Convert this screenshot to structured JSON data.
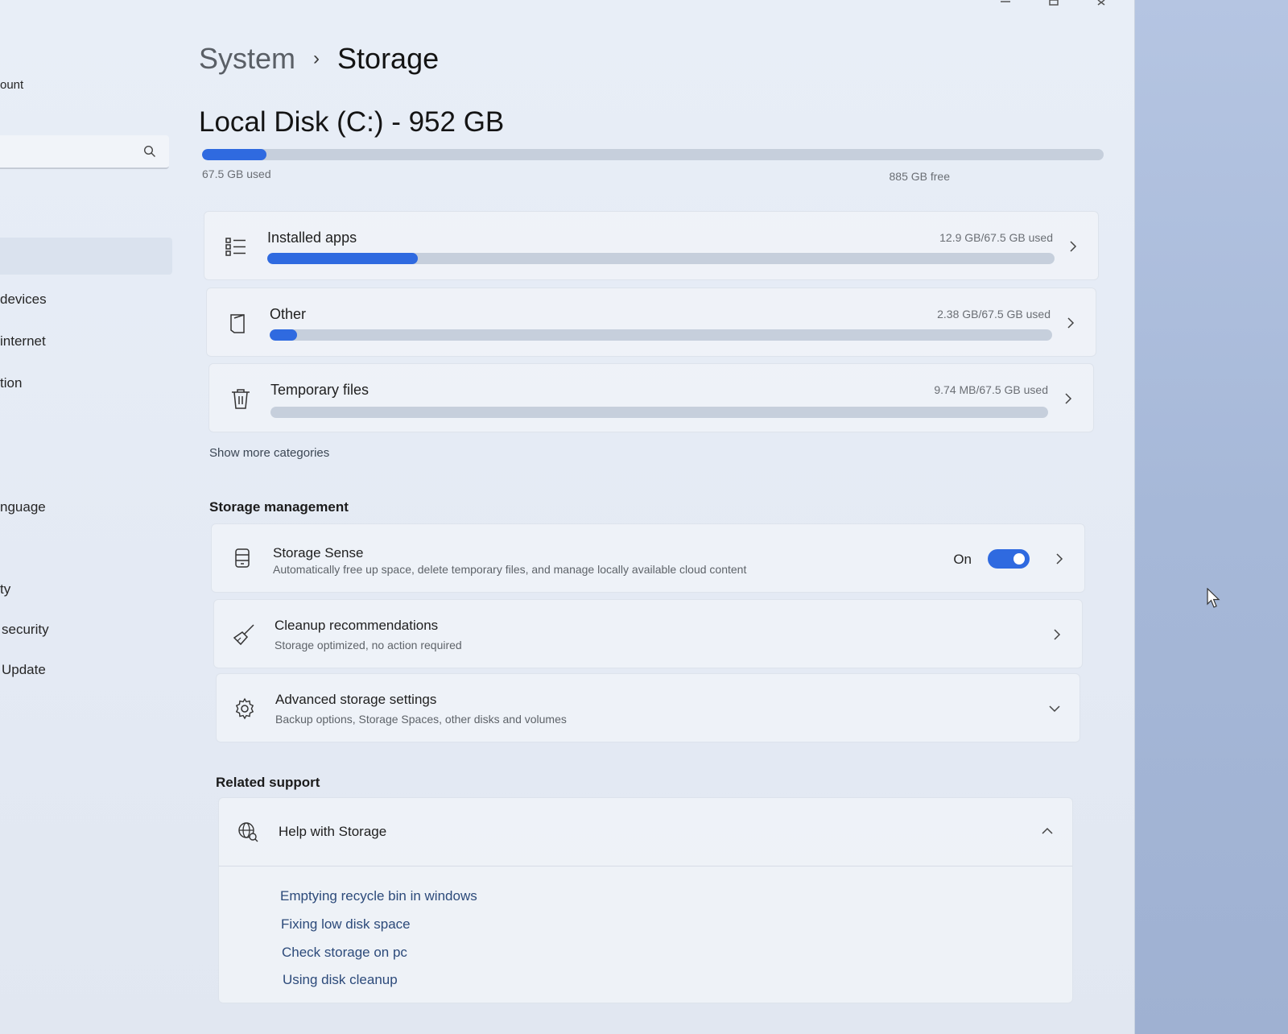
{
  "sidebar": {
    "items": [
      {
        "label": "ount"
      },
      {
        "label": "devices"
      },
      {
        "label": "internet"
      },
      {
        "label": "tion"
      },
      {
        "label": "nguage"
      },
      {
        "label": "ty"
      },
      {
        "label": "security"
      },
      {
        "label": "Update"
      }
    ]
  },
  "breadcrumb": {
    "parent": "System",
    "separator": "›",
    "current": "Storage"
  },
  "disk": {
    "title": "Local Disk (C:) - 952 GB",
    "used_label": "67.5 GB used",
    "free_label": "885 GB free",
    "used_fraction": 0.071
  },
  "categories": [
    {
      "label": "Installed apps",
      "value": "12.9 GB/67.5 GB used",
      "fraction": 0.191,
      "icon": "list-icon"
    },
    {
      "label": "Other",
      "value": "2.38 GB/67.5 GB used",
      "fraction": 0.035,
      "icon": "document-icon"
    },
    {
      "label": "Temporary files",
      "value": "9.74 MB/67.5 GB used",
      "fraction": 0.0,
      "icon": "trash-icon"
    }
  ],
  "show_more": "Show more categories",
  "storage_management": {
    "title": "Storage management",
    "rows": [
      {
        "title": "Storage Sense",
        "subtitle": "Automatically free up space, delete temporary files, and manage locally available cloud content",
        "toggle_label": "On",
        "toggle_on": true,
        "icon": "drive-icon"
      },
      {
        "title": "Cleanup recommendations",
        "subtitle": "Storage optimized, no action required",
        "icon": "broom-icon"
      },
      {
        "title": "Advanced storage settings",
        "subtitle": "Backup options, Storage Spaces, other disks and volumes",
        "icon": "gear-icon"
      }
    ]
  },
  "related_support": {
    "title": "Related support",
    "help_title": "Help with Storage",
    "links": [
      "Emptying recycle bin in windows",
      "Fixing low disk space",
      "Check storage on pc",
      "Using disk cleanup"
    ]
  },
  "colors": {
    "accent": "#2f6ae0",
    "track": "#c6cfdc"
  }
}
